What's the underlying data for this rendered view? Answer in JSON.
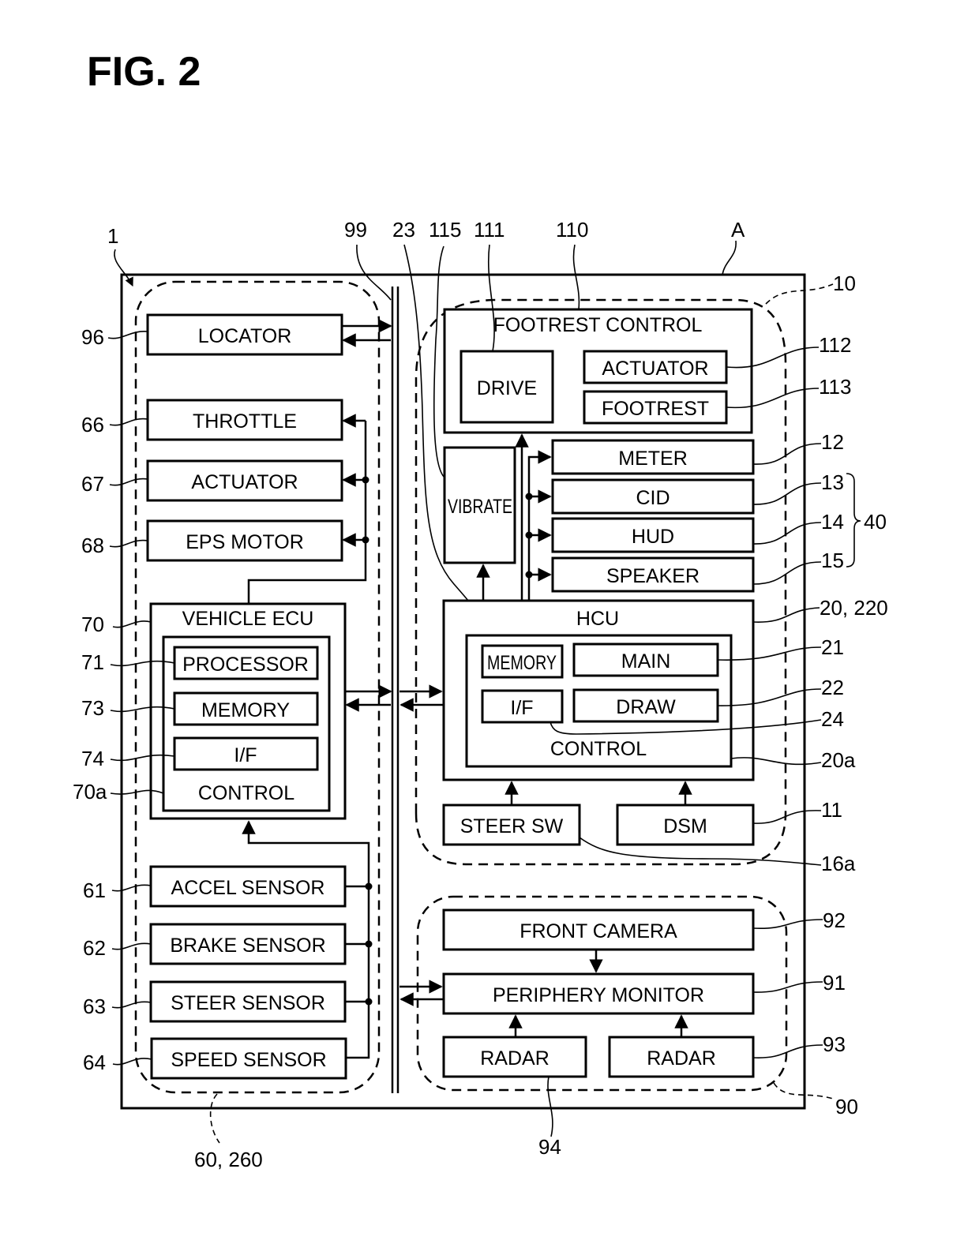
{
  "figure": {
    "title": "FIG. 2",
    "vehicle_ref": "A",
    "system_ref": "1",
    "bus_ref": "99"
  },
  "left_group": {
    "ref": "60, 260",
    "blocks": {
      "locator": {
        "label": "LOCATOR",
        "ref": "96"
      },
      "throttle": {
        "label": "THROTTLE",
        "ref": "66"
      },
      "actuator": {
        "label": "ACTUATOR",
        "ref": "67"
      },
      "eps_motor": {
        "label": "EPS MOTOR",
        "ref": "68"
      },
      "vehicle_ecu": {
        "label": "VEHICLE ECU",
        "ref": "70",
        "control": {
          "label": "CONTROL",
          "ref": "70a"
        },
        "processor": {
          "label": "PROCESSOR",
          "ref": "71"
        },
        "memory": {
          "label": "MEMORY",
          "ref": "73"
        },
        "interface": {
          "label": "I/F",
          "ref": "74"
        }
      },
      "accel_sensor": {
        "label": "ACCEL SENSOR",
        "ref": "61"
      },
      "brake_sensor": {
        "label": "BRAKE SENSOR",
        "ref": "62"
      },
      "steer_sensor": {
        "label": "STEER SENSOR",
        "ref": "63"
      },
      "speed_sensor": {
        "label": "SPEED SENSOR",
        "ref": "64"
      }
    }
  },
  "hmi_group": {
    "ref": "10",
    "footrest_control": {
      "label": "FOOTREST CONTROL",
      "ref": "110",
      "drive": {
        "label": "DRIVE",
        "ref": "111"
      },
      "actuator": {
        "label": "ACTUATOR",
        "ref": "112"
      },
      "footrest": {
        "label": "FOOTREST",
        "ref": "113"
      }
    },
    "vibrate": {
      "label": "VIBRATE",
      "ref": "115"
    },
    "meter": {
      "label": "METER",
      "ref": "12"
    },
    "cid": {
      "label": "CID",
      "ref": "13"
    },
    "hud": {
      "label": "HUD",
      "ref": "14"
    },
    "speaker": {
      "label": "SPEAKER",
      "ref": "15"
    },
    "display_group_ref": "40",
    "hcu": {
      "label": "HCU",
      "ref": "20, 220",
      "control": {
        "label": "CONTROL",
        "ref": "20a"
      },
      "memory": {
        "label": "MEMORY",
        "ref": "23"
      },
      "main": {
        "label": "MAIN",
        "ref": "21"
      },
      "interface": {
        "label": "I/F",
        "ref": "24"
      },
      "draw": {
        "label": "DRAW",
        "ref": "22"
      }
    },
    "steer_sw": {
      "label": "STEER SW",
      "ref": "16a"
    },
    "dsm": {
      "label": "DSM",
      "ref": "11"
    }
  },
  "periphery_group": {
    "ref": "90",
    "front_camera": {
      "label": "FRONT CAMERA",
      "ref": "92"
    },
    "periphery_monitor": {
      "label": "PERIPHERY MONITOR",
      "ref": "91"
    },
    "radar_left": {
      "label": "RADAR",
      "ref": "94"
    },
    "radar_right": {
      "label": "RADAR",
      "ref": "93"
    }
  }
}
